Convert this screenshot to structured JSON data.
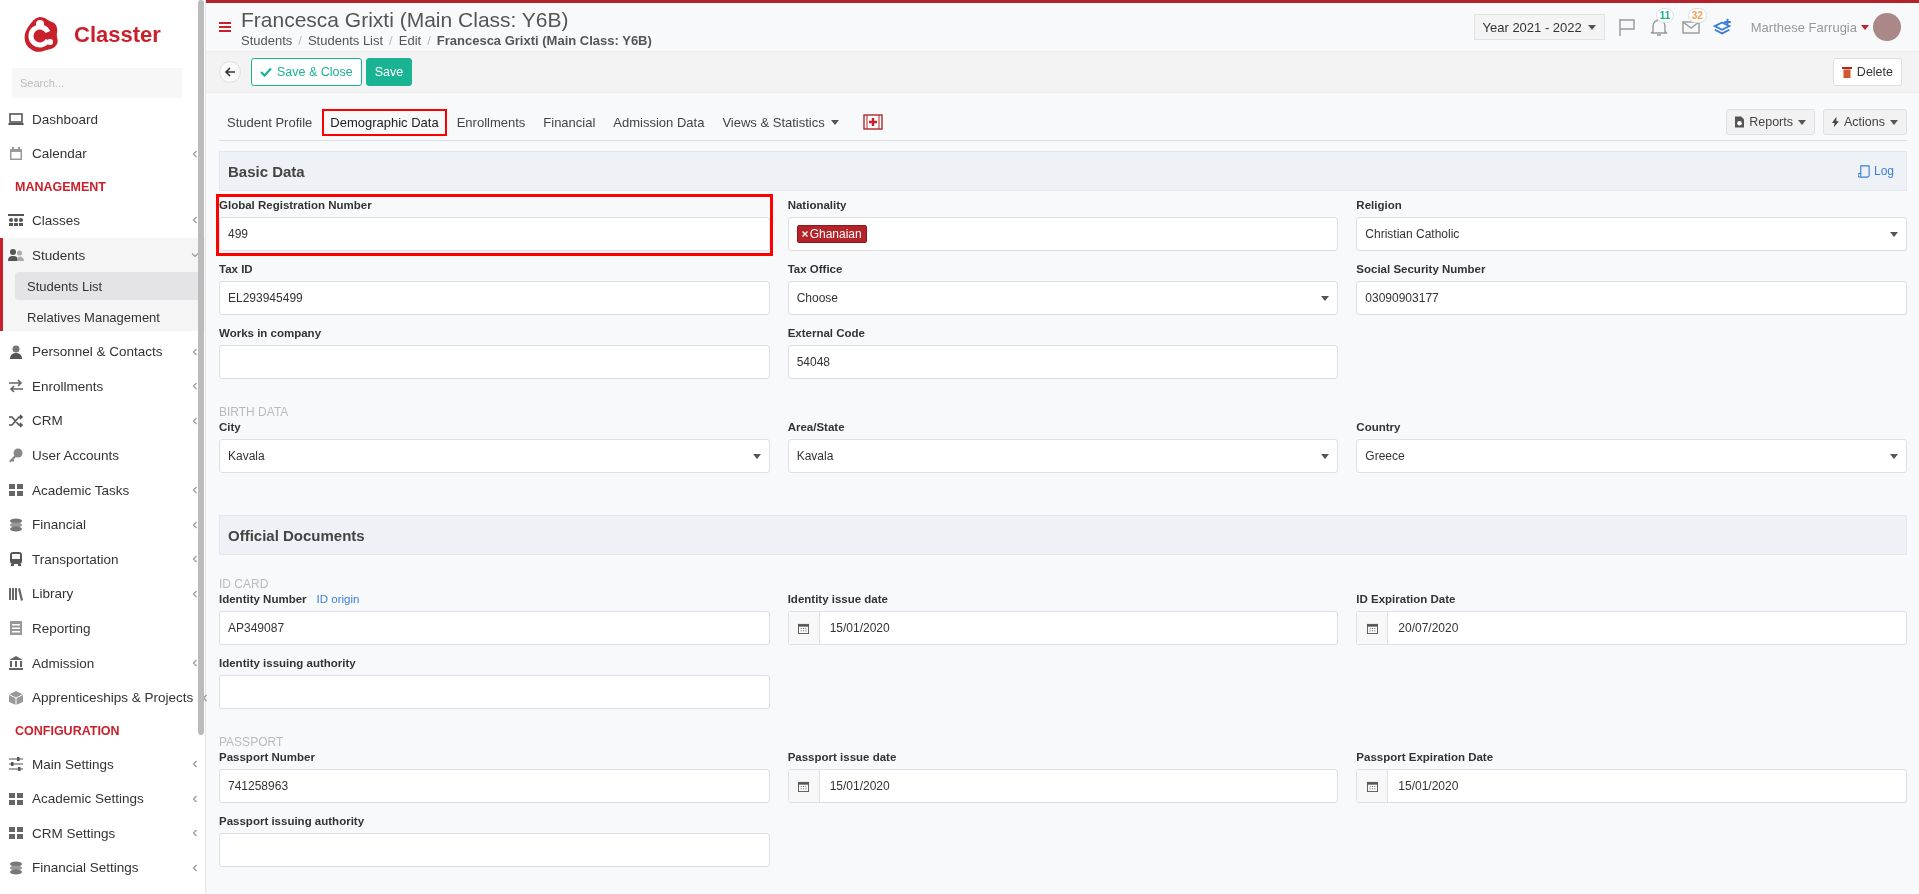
{
  "sidebar": {
    "brand": "Classter",
    "search": {
      "placeholder": "Search..."
    },
    "items": [
      {
        "kind": "item",
        "label": "Dashboard"
      },
      {
        "kind": "item",
        "label": "Calendar",
        "expanded": false
      },
      {
        "kind": "heading",
        "label": "MANAGEMENT"
      },
      {
        "kind": "item",
        "label": "Classes",
        "expanded": false
      },
      {
        "kind": "item",
        "label": "Students",
        "expanded": true,
        "children": [
          {
            "label": "Students List",
            "selected": true
          },
          {
            "label": "Relatives Management",
            "selected": false
          }
        ]
      },
      {
        "kind": "item",
        "label": "Personnel & Contacts",
        "expanded": false
      },
      {
        "kind": "item",
        "label": "Enrollments",
        "expanded": false
      },
      {
        "kind": "item",
        "label": "CRM",
        "expanded": false
      },
      {
        "kind": "item",
        "label": "User Accounts"
      },
      {
        "kind": "item",
        "label": "Academic Tasks",
        "expanded": false
      },
      {
        "kind": "item",
        "label": "Financial",
        "expanded": false
      },
      {
        "kind": "item",
        "label": "Transportation",
        "expanded": false
      },
      {
        "kind": "item",
        "label": "Library",
        "expanded": false
      },
      {
        "kind": "item",
        "label": "Reporting"
      },
      {
        "kind": "item",
        "label": "Admission",
        "expanded": false
      },
      {
        "kind": "item",
        "label": "Apprenticeships & Projects",
        "expanded": false
      },
      {
        "kind": "heading",
        "label": "CONFIGURATION"
      },
      {
        "kind": "item",
        "label": "Main Settings",
        "expanded": false
      },
      {
        "kind": "item",
        "label": "Academic Settings",
        "expanded": false
      },
      {
        "kind": "item",
        "label": "CRM Settings",
        "expanded": false
      },
      {
        "kind": "item",
        "label": "Financial Settings",
        "expanded": false
      }
    ]
  },
  "header": {
    "title": "Francesca Grixti (Main Class: Y6B)",
    "breadcrumb": [
      "Students",
      "Students List",
      "Edit",
      "Francesca Grixti (Main Class: Y6B)"
    ],
    "breadcrumb_separator": "/",
    "year": "Year 2021 - 2022",
    "notifications": [
      {
        "kind": "bell",
        "count": "11",
        "color": "#1ab394"
      },
      {
        "kind": "mail",
        "count": "32",
        "color": "#f0a050"
      }
    ],
    "user": "Marthese Farrugia"
  },
  "toolbar": {
    "save_close": "Save & Close",
    "save": "Save",
    "delete": "Delete"
  },
  "tabs": [
    {
      "label": "Student Profile",
      "selected": false,
      "dropdown": false
    },
    {
      "label": "Demographic Data",
      "selected": true,
      "dropdown": false
    },
    {
      "label": "Enrollments",
      "selected": false,
      "dropdown": false
    },
    {
      "label": "Financial",
      "selected": false,
      "dropdown": false
    },
    {
      "label": "Admission Data",
      "selected": false,
      "dropdown": false
    },
    {
      "label": "Views & Statistics",
      "selected": false,
      "dropdown": true
    }
  ],
  "tab_actions": [
    "Reports",
    "Actions"
  ],
  "sections": [
    {
      "title": "Basic Data",
      "log": "Log",
      "items": [
        {
          "kind": "text",
          "label": "Global Registration Number",
          "value": "499",
          "highlighted": true
        },
        {
          "kind": "tags",
          "label": "Nationality",
          "tags": [
            "Ghanaian"
          ]
        },
        {
          "kind": "select",
          "label": "Religion",
          "value": "Christian Catholic"
        },
        {
          "kind": "text",
          "label": "Tax ID",
          "value": "EL293945499"
        },
        {
          "kind": "select",
          "label": "Tax Office",
          "value": "Choose"
        },
        {
          "kind": "text",
          "label": "Social Security Number",
          "value": "03090903177"
        },
        {
          "kind": "text",
          "label": "Works in company"
        },
        {
          "kind": "text",
          "label": "External Code",
          "value": "54048"
        },
        {
          "kind": "subheading",
          "label": "BIRTH DATA"
        },
        {
          "kind": "select",
          "label": "City",
          "value": "Kavala"
        },
        {
          "kind": "select",
          "label": "Area/State",
          "value": "Kavala"
        },
        {
          "kind": "select",
          "label": "Country",
          "value": "Greece"
        }
      ]
    },
    {
      "title": "Official Documents",
      "items": [
        {
          "kind": "subheading",
          "label": "ID CARD"
        },
        {
          "kind": "text",
          "label": "Identity Number",
          "link": "ID origin",
          "value": "AP349087"
        },
        {
          "kind": "date",
          "label": "Identity issue date",
          "value": "15/01/2020"
        },
        {
          "kind": "date",
          "label": "ID Expiration Date",
          "value": "20/07/2020"
        },
        {
          "kind": "text",
          "label": "Identity issuing authority"
        },
        {
          "kind": "subheading",
          "label": "PASSPORT"
        },
        {
          "kind": "text",
          "label": "Passport Number",
          "value": "741258963"
        },
        {
          "kind": "date",
          "label": "Passport issue date",
          "value": "15/01/2020"
        },
        {
          "kind": "date",
          "label": "Passport Expiration Date",
          "value": "15/01/2020"
        },
        {
          "kind": "text",
          "label": "Passport issuing authority"
        }
      ]
    }
  ]
}
